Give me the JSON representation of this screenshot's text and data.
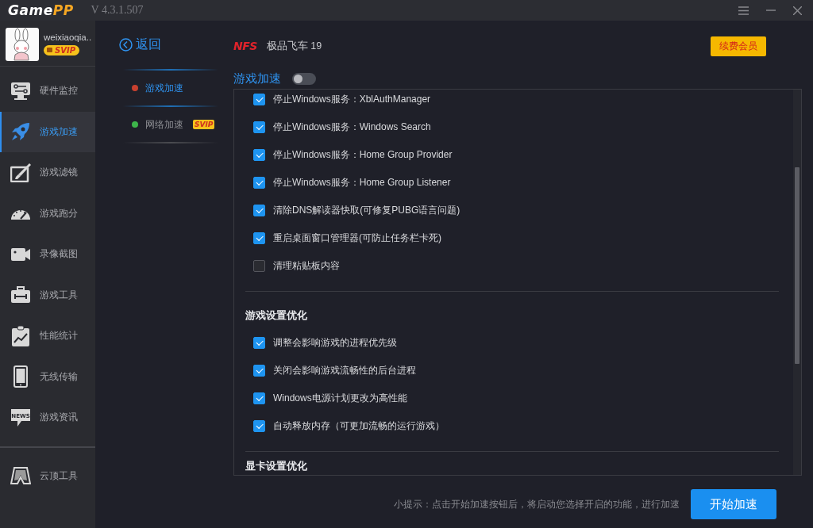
{
  "app": {
    "logo_main": "Game",
    "logo_accent": "PP",
    "version": "V 4.3.1.507"
  },
  "user": {
    "name": "weixiaoqia..",
    "badge": "SVIP"
  },
  "sidebar": {
    "items": [
      {
        "label": "硬件监控",
        "selected": false
      },
      {
        "label": "游戏加速",
        "selected": true
      },
      {
        "label": "游戏滤镜",
        "selected": false
      },
      {
        "label": "游戏跑分",
        "selected": false
      },
      {
        "label": "录像截图",
        "selected": false
      },
      {
        "label": "游戏工具",
        "selected": false
      },
      {
        "label": "性能统计",
        "selected": false
      },
      {
        "label": "无线传输",
        "selected": false
      },
      {
        "label": "游戏资讯",
        "selected": false,
        "icon_text": "NEWS"
      }
    ],
    "bottom_items": [
      {
        "label": "云顶工具",
        "selected": false
      }
    ]
  },
  "back": "返回",
  "subnav": [
    {
      "label": "游戏加速",
      "selected": true,
      "color": "#c8402f"
    },
    {
      "label": "网络加速",
      "selected": false,
      "color": "#3db54a",
      "badge": "SVIP"
    }
  ],
  "game": {
    "logo": "NFS",
    "title": "极品飞车 19"
  },
  "renew_button": "续费会员",
  "acceleration": {
    "label": "游戏加速",
    "on": false
  },
  "sections": [
    {
      "items": [
        {
          "label": "停止Windows服务：XblAuthManager",
          "checked": true
        },
        {
          "label": "停止Windows服务：Windows Search",
          "checked": true
        },
        {
          "label": "停止Windows服务：Home Group Provider",
          "checked": true
        },
        {
          "label": "停止Windows服务：Home Group Listener",
          "checked": true
        },
        {
          "label": "清除DNS解读器快取(可修复PUBG语言问题)",
          "checked": true
        },
        {
          "label": "重启桌面窗口管理器(可防止任务栏卡死)",
          "checked": true
        },
        {
          "label": "清理粘贴板内容",
          "checked": false
        }
      ]
    },
    {
      "heading": "游戏设置优化",
      "items": [
        {
          "label": "调整会影响游戏的进程优先级",
          "checked": true
        },
        {
          "label": "关闭会影响游戏流畅性的后台进程",
          "checked": true
        },
        {
          "label": "Windows电源计划更改为高性能",
          "checked": true
        },
        {
          "label": "自动释放内存（可更加流畅的运行游戏）",
          "checked": true
        }
      ]
    },
    {
      "heading": "显卡设置优化"
    }
  ],
  "tip": "小提示：点击开始加速按钮后，将启动您选择开启的功能，进行加速",
  "start_button": "开始加速"
}
